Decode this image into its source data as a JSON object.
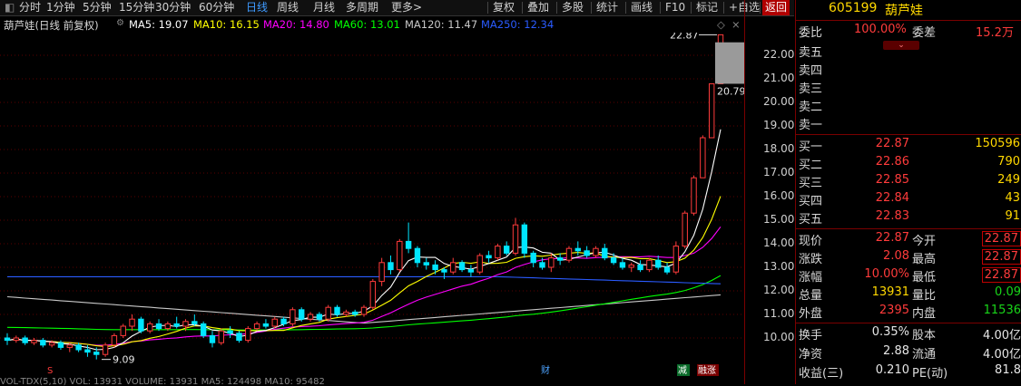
{
  "toolbar": {
    "left": [
      {
        "id": "tb-fenshi",
        "label": "分时"
      },
      {
        "id": "tb-1min",
        "label": "1分钟"
      },
      {
        "id": "tb-5min",
        "label": "5分钟"
      },
      {
        "id": "tb-15min",
        "label": "15分钟"
      },
      {
        "id": "tb-30min",
        "label": "30分钟"
      },
      {
        "id": "tb-60min",
        "label": "60分钟"
      },
      {
        "id": "tb-daily",
        "label": "日线",
        "active": true
      },
      {
        "id": "tb-weekly",
        "label": "周线"
      },
      {
        "id": "tb-monthly",
        "label": "月线"
      },
      {
        "id": "tb-multi",
        "label": "多周期"
      },
      {
        "id": "tb-more",
        "label": "更多>"
      }
    ],
    "right": [
      {
        "id": "tb-fuquan",
        "label": "复权"
      },
      {
        "id": "tb-overlay",
        "label": "叠加"
      },
      {
        "id": "tb-multistock",
        "label": "多股"
      },
      {
        "id": "tb-stats",
        "label": "统计"
      },
      {
        "id": "tb-draw",
        "label": "画线"
      },
      {
        "id": "tb-f10",
        "label": "F10"
      },
      {
        "id": "tb-mark",
        "label": "标记"
      },
      {
        "id": "tb-fav",
        "label": "+自选"
      },
      {
        "id": "tb-back",
        "label": "返回"
      }
    ]
  },
  "chart_header": {
    "title": "葫芦娃(日线 前复权)",
    "ma": [
      {
        "label": "MA5: 19.07",
        "color": "#ffffff"
      },
      {
        "label": "MA10: 16.15",
        "color": "#ffff00"
      },
      {
        "label": "MA20: 14.80",
        "color": "#ff00ff"
      },
      {
        "label": "MA60: 13.01",
        "color": "#00ff00"
      },
      {
        "label": "MA120: 11.47",
        "color": "#c8c8c8"
      },
      {
        "label": "MA250: 12.34",
        "color": "#2a5bff"
      }
    ]
  },
  "chart_data": {
    "type": "candlestick",
    "ylim": [
      9.0,
      23.0
    ],
    "y_ticks": [
      "22.00",
      "21.00",
      "20.00",
      "19.00",
      "18.00",
      "17.00",
      "16.00",
      "15.00",
      "14.00",
      "13.00",
      "12.00",
      "11.00",
      "10.00"
    ],
    "price_labels": {
      "top": "22.87",
      "bottom": "20.79",
      "low": "9.09"
    },
    "marker_labels": {
      "event_s": "S",
      "cai": "财",
      "jian": "减",
      "rongzi": "融涨"
    },
    "colors": {
      "up": "#ff3b3b",
      "down": "#00e5ff",
      "ma5": "#ffffff",
      "ma10": "#ffff00",
      "ma20": "#ff00ff",
      "ma60": "#00ff00",
      "ma120": "#c8c8c8",
      "ma250": "#2a5bff",
      "grid": "#5a0000"
    },
    "candles": [
      [
        10.0,
        10.2,
        9.7,
        9.9
      ],
      [
        9.9,
        10.1,
        9.8,
        10.0
      ],
      [
        10.0,
        10.1,
        9.7,
        9.8
      ],
      [
        9.8,
        10.0,
        9.7,
        9.9
      ],
      [
        9.9,
        10.0,
        9.6,
        9.7
      ],
      [
        9.7,
        9.9,
        9.6,
        9.8
      ],
      [
        9.8,
        9.9,
        9.5,
        9.6
      ],
      [
        9.6,
        9.8,
        9.4,
        9.7
      ],
      [
        9.7,
        9.8,
        9.4,
        9.5
      ],
      [
        9.5,
        9.7,
        9.2,
        9.4
      ],
      [
        9.4,
        9.6,
        9.09,
        9.3
      ],
      [
        9.3,
        9.8,
        9.2,
        9.7
      ],
      [
        9.7,
        10.2,
        9.6,
        10.1
      ],
      [
        10.1,
        10.6,
        10.0,
        10.5
      ],
      [
        10.5,
        11.0,
        10.3,
        10.8
      ],
      [
        10.8,
        10.9,
        10.2,
        10.3
      ],
      [
        10.3,
        10.7,
        10.2,
        10.6
      ],
      [
        10.6,
        10.8,
        10.3,
        10.4
      ],
      [
        10.4,
        10.7,
        10.3,
        10.6
      ],
      [
        10.6,
        10.9,
        10.4,
        10.5
      ],
      [
        10.5,
        10.8,
        10.3,
        10.7
      ],
      [
        10.7,
        11.0,
        10.5,
        10.6
      ],
      [
        10.6,
        10.7,
        10.0,
        10.1
      ],
      [
        10.1,
        10.3,
        9.6,
        9.8
      ],
      [
        9.8,
        10.4,
        9.7,
        10.3
      ],
      [
        10.3,
        10.5,
        10.0,
        10.2
      ],
      [
        10.2,
        10.3,
        9.8,
        9.9
      ],
      [
        9.9,
        10.5,
        9.8,
        10.4
      ],
      [
        10.4,
        10.7,
        10.3,
        10.6
      ],
      [
        10.6,
        10.8,
        10.4,
        10.5
      ],
      [
        10.5,
        10.9,
        10.4,
        10.8
      ],
      [
        10.8,
        10.9,
        10.5,
        10.6
      ],
      [
        10.6,
        11.3,
        10.5,
        11.2
      ],
      [
        11.2,
        11.3,
        10.7,
        10.8
      ],
      [
        10.8,
        11.1,
        10.7,
        11.0
      ],
      [
        11.0,
        11.1,
        10.7,
        10.8
      ],
      [
        10.8,
        11.4,
        10.7,
        11.3
      ],
      [
        11.3,
        11.4,
        10.9,
        11.0
      ],
      [
        11.0,
        11.2,
        10.9,
        11.1
      ],
      [
        11.1,
        11.2,
        10.9,
        11.0
      ],
      [
        11.0,
        11.4,
        10.9,
        11.3
      ],
      [
        11.3,
        12.5,
        11.2,
        12.4
      ],
      [
        12.4,
        13.4,
        12.2,
        13.2
      ],
      [
        13.2,
        13.5,
        12.7,
        12.9
      ],
      [
        12.9,
        14.2,
        12.8,
        14.1
      ],
      [
        14.1,
        14.9,
        13.6,
        13.8
      ],
      [
        13.8,
        13.9,
        13.0,
        13.2
      ],
      [
        13.2,
        13.4,
        12.9,
        13.1
      ],
      [
        13.1,
        13.3,
        12.7,
        12.9
      ],
      [
        12.9,
        13.0,
        12.5,
        12.8
      ],
      [
        12.8,
        13.4,
        12.7,
        13.2
      ],
      [
        13.2,
        13.3,
        12.8,
        12.9
      ],
      [
        12.9,
        13.1,
        12.6,
        12.8
      ],
      [
        12.8,
        13.6,
        12.7,
        13.5
      ],
      [
        13.5,
        13.7,
        13.2,
        13.4
      ],
      [
        13.4,
        14.0,
        13.3,
        13.9
      ],
      [
        13.9,
        14.1,
        13.5,
        13.6
      ],
      [
        13.6,
        15.1,
        13.5,
        14.8
      ],
      [
        14.8,
        14.9,
        13.4,
        13.6
      ],
      [
        13.6,
        13.7,
        13.0,
        13.2
      ],
      [
        13.2,
        13.4,
        12.9,
        13.0
      ],
      [
        13.0,
        13.6,
        12.8,
        13.4
      ],
      [
        13.4,
        13.6,
        13.1,
        13.3
      ],
      [
        13.3,
        13.9,
        13.2,
        13.8
      ],
      [
        13.8,
        14.1,
        13.5,
        13.7
      ],
      [
        13.7,
        13.9,
        13.4,
        13.5
      ],
      [
        13.5,
        13.9,
        13.4,
        13.8
      ],
      [
        13.8,
        14.0,
        13.3,
        13.4
      ],
      [
        13.4,
        13.6,
        13.1,
        13.2
      ],
      [
        13.2,
        13.4,
        12.9,
        13.0
      ],
      [
        13.0,
        13.2,
        12.8,
        13.1
      ],
      [
        13.1,
        13.3,
        12.8,
        12.9
      ],
      [
        12.9,
        13.4,
        12.8,
        13.3
      ],
      [
        13.3,
        13.5,
        12.9,
        13.0
      ],
      [
        13.0,
        13.2,
        12.7,
        12.8
      ],
      [
        12.8,
        14.1,
        12.7,
        13.9
      ],
      [
        13.9,
        15.4,
        13.8,
        15.3
      ],
      [
        15.3,
        16.9,
        15.2,
        16.8
      ],
      [
        16.8,
        18.6,
        16.8,
        18.5
      ],
      [
        18.5,
        20.79,
        18.5,
        20.79
      ],
      [
        20.79,
        22.87,
        20.79,
        22.87
      ]
    ]
  },
  "vol_header": "VOL-TDX(5,10)  VOL: 13931  VOLUME: 13931  MA5: 124498  MA10: 95482",
  "quote": {
    "code": "605199",
    "name": "葫芦娃",
    "weibi_label": "委比",
    "weibi_value": "100.00%",
    "weicha_label": "委差",
    "weicha_value": "15.2万",
    "sell": [
      {
        "label": "卖五",
        "price": "",
        "vol": ""
      },
      {
        "label": "卖四",
        "price": "",
        "vol": ""
      },
      {
        "label": "卖三",
        "price": "",
        "vol": ""
      },
      {
        "label": "卖二",
        "price": "",
        "vol": ""
      },
      {
        "label": "卖一",
        "price": "",
        "vol": ""
      }
    ],
    "buy": [
      {
        "label": "买一",
        "price": "22.87",
        "vol": "150596"
      },
      {
        "label": "买二",
        "price": "22.86",
        "vol": "790"
      },
      {
        "label": "买三",
        "price": "22.85",
        "vol": "249"
      },
      {
        "label": "买四",
        "price": "22.84",
        "vol": "43"
      },
      {
        "label": "买五",
        "price": "22.83",
        "vol": "91"
      }
    ],
    "stats": [
      {
        "l1": "现价",
        "v1": "22.87",
        "c1": "red",
        "l2": "今开",
        "v2": "22.87",
        "c2": "red",
        "b2": true
      },
      {
        "l1": "涨跌",
        "v1": "2.08",
        "c1": "red",
        "l2": "最高",
        "v2": "22.87",
        "c2": "red",
        "b2": true
      },
      {
        "l1": "涨幅",
        "v1": "10.00%",
        "c1": "red",
        "l2": "最低",
        "v2": "22.87",
        "c2": "red",
        "b2": true
      },
      {
        "l1": "总量",
        "v1": "13931",
        "c1": "yellow",
        "l2": "量比",
        "v2": "0.09",
        "c2": "green",
        "b2": false
      },
      {
        "l1": "外盘",
        "v1": "2395",
        "c1": "red",
        "l2": "内盘",
        "v2": "11536",
        "c2": "green",
        "b2": false
      }
    ],
    "fund": [
      {
        "l1": "换手",
        "v1": "0.35%",
        "l2": "股本",
        "v2": "4.00亿"
      },
      {
        "l1": "净资",
        "v1": "2.88",
        "l2": "流通",
        "v2": "4.00亿"
      },
      {
        "l1": "收益(三)",
        "v1": "0.210",
        "l2": "PE(动)",
        "v2": "81.8"
      }
    ]
  }
}
